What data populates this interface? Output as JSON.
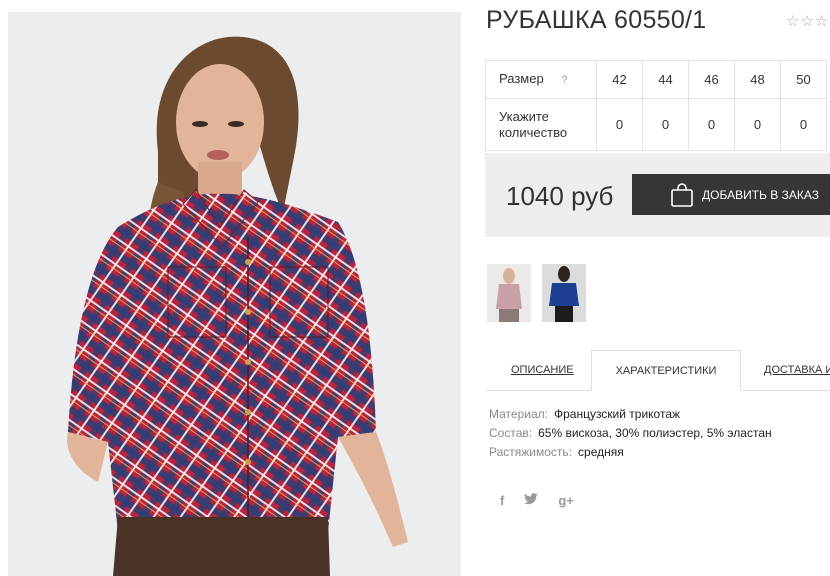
{
  "product": {
    "title": "РУБАШКА 60550/1",
    "rating_stars": "☆☆☆"
  },
  "sizes_table": {
    "size_label": "Размер",
    "help_symbol": "?",
    "sizes": [
      "42",
      "44",
      "46",
      "48",
      "50"
    ],
    "qty_label_line1": "Укажите",
    "qty_label_line2": "количество",
    "quantities": [
      "0",
      "0",
      "0",
      "0",
      "0"
    ]
  },
  "order": {
    "price": "1040 руб",
    "button_label": "ДОБАВИТЬ В ЗАКАЗ"
  },
  "tabs": [
    {
      "label": "ОПИСАНИЕ",
      "active": false
    },
    {
      "label": "ХАРАКТЕРИСТИКИ",
      "active": true
    },
    {
      "label": "ДОСТАВКА И",
      "active": false
    }
  ],
  "specs": [
    {
      "key": "Материал:",
      "value": "Французский трикотаж"
    },
    {
      "key": "Состав:",
      "value": "65% вискоза, 30% полиэстер, 5% эластан"
    },
    {
      "key": "Растяжимость:",
      "value": "средняя"
    }
  ],
  "social": {
    "facebook": "f",
    "twitter": "🐦",
    "google_plus": "g+"
  },
  "colors": {
    "button_bg": "#363636",
    "price_bg": "#eeeeee",
    "shirt_red": "#b8233d",
    "shirt_navy": "#2a3f78",
    "pants_brown": "#4a3226"
  }
}
